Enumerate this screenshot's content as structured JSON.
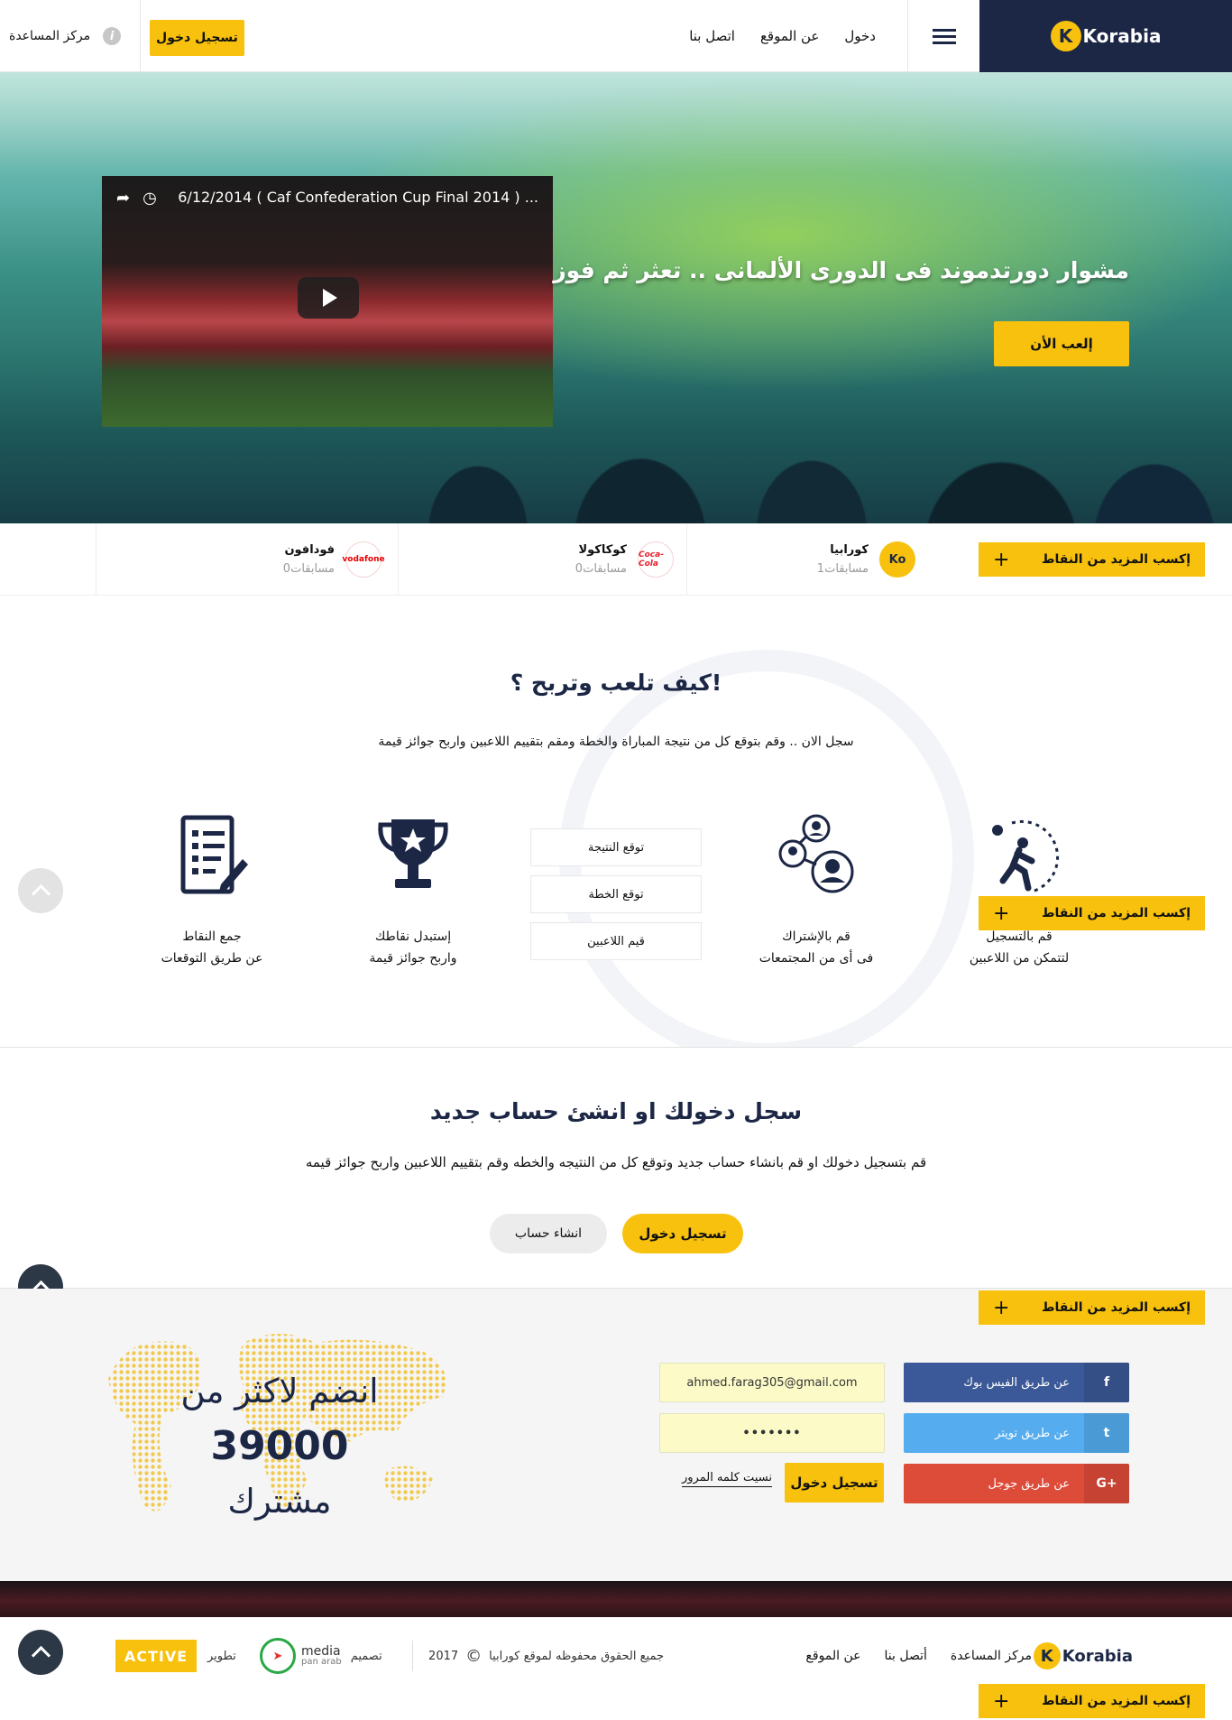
{
  "header": {
    "logo_text": "Korabia",
    "logo_k": "K",
    "nav": [
      "دخول",
      "عن الموقع",
      "اتصل بنا"
    ],
    "login_button": "تسجيل دخول",
    "help_label": "مركز المساعدة",
    "help_icon": "i"
  },
  "hero": {
    "video_title": "6/12/2014 ( Caf Confederation Cup Final 2014 ) ...",
    "headline": "مشوار دورتدموند فى الدورى الألمانى .. تعثر ثم فوز",
    "cta": "إلعب الأن"
  },
  "sponsors": [
    {
      "name": "كورابيا",
      "count": "1مسابقات",
      "logo_text": "Ko",
      "color": "#f7c10d"
    },
    {
      "name": "كوكاكولا",
      "count": "0مسابقات",
      "logo_text": "Coca-Cola",
      "color": "#e4202c"
    },
    {
      "name": "فودافون",
      "count": "0مسابقات",
      "logo_text": "vodafone",
      "color": "#e60000"
    }
  ],
  "points_tab": {
    "label": "إكسب المزيد من النقاط",
    "plus": "+"
  },
  "how": {
    "title": "كيف تلعب وتربح ؟!",
    "subtitle": "سجل الان .. وقم بتوقع كل من نتيجة المباراة والخطة ومقم بتقييم اللاعبين واربح جوائز قيمة",
    "steps": [
      {
        "line1": "قم بالتسجيل",
        "line2": "لتتمكن من اللاعبين"
      },
      {
        "line1": "قم بالإشتراك",
        "line2": "فى أى من المجتمعات"
      },
      {
        "line1": "إستبدل نقاطك",
        "line2": "واربح جوائز قيمة"
      },
      {
        "line1": "جمع النقاط",
        "line2": "عن طريق التوقعات"
      }
    ],
    "predictions": [
      "توقع النتيجة",
      "توقع الخطة",
      "قيم اللاعبين"
    ]
  },
  "login_section": {
    "title": "سجل دخولك او انشئ حساب جديد",
    "subtitle": "قم بتسجيل دخولك او قم بانشاء حساب جديد وتوقع كل من النتيجه والخطه وقم بتقييم اللاعبين واربح جوائز قيمه",
    "login_button": "تسجيل دخول",
    "create_button": "انشاء حساب"
  },
  "join": {
    "facebook": "عن طريق الفيس بوك",
    "twitter": "عن طريق تويتر",
    "google": "عن طريق جوجل",
    "facebook_icon": "f",
    "twitter_icon": "t",
    "google_icon": "G+",
    "email_value": "ahmed.farag305@gmail.com",
    "password_value": "•••••••",
    "login_button": "تسجيل دخول",
    "forgot": "نسيت كلمه المرور",
    "headline_top": "انضم لاكثر من",
    "count": "39000",
    "headline_bottom": "مشترك"
  },
  "footer": {
    "logo_text": "Korabia",
    "logo_k": "K",
    "links": [
      "مركز المساعدة",
      "أتصل بنا",
      "عن الموقع"
    ],
    "copyright": "جميع الحقوق محفوظه لموقع كورابيا",
    "copyright_symbol": "©",
    "year": "2017",
    "design_label": "تصميم",
    "design_logo": "media",
    "design_logo_sub": "pan arab",
    "dev_label": "تطوير",
    "dev_logo": "ACTIVE"
  },
  "colors": {
    "accent": "#f7c10d",
    "navy": "#1c2746",
    "facebook": "#3b5998",
    "twitter": "#55acee",
    "google": "#dd4b39"
  }
}
